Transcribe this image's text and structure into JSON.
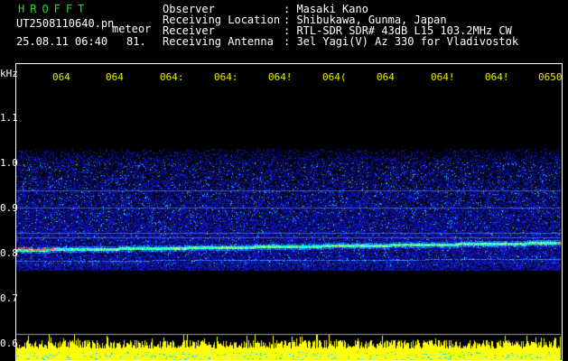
{
  "header": {
    "brand": "HROFFT",
    "filename": "UT2508110640.pn",
    "meteor_label": "meteor",
    "datetime": "25.08.11 06:40",
    "count": "81.",
    "fields": [
      {
        "label": "Observer",
        "value": ": Masaki Kano"
      },
      {
        "label": "Receiving Location",
        "value": ": Shibukawa, Gunma, Japan"
      },
      {
        "label": "Receiver",
        "value": ": RTL-SDR SDR# 43dB L15 103.2MHz CW"
      },
      {
        "label": "Receiving Antenna",
        "value": ": 3el Yagi(V) Az 330 for Vladivostok"
      }
    ]
  },
  "axis": {
    "unit": "kHz",
    "y_ticks": [
      "1.1",
      "1.0",
      "0.9",
      "0.8",
      "0.7",
      "0.6"
    ],
    "x_ticks": [
      "064",
      "064",
      "064:",
      "064:",
      "064!",
      "064(",
      "064",
      "064!",
      "064!",
      "0650"
    ]
  },
  "colors": {
    "background": "#000000",
    "noise": "#1030ff",
    "echo_line": "#00ffff",
    "meteor_trace": "#ff3030",
    "activity_bar": "#ffff00"
  }
}
